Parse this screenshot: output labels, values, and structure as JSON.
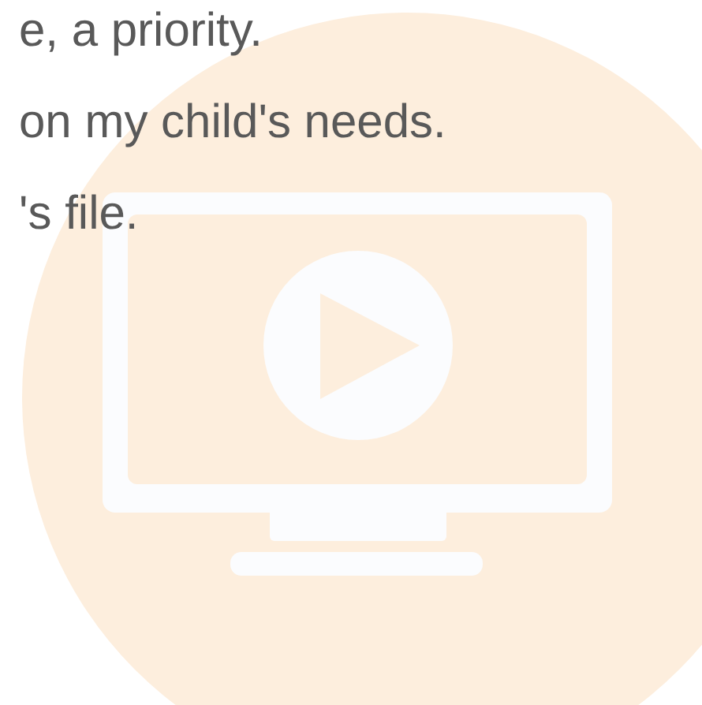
{
  "paragraph_lines": [
    "e, a priority.",
    "on my child's needs.",
    "'s file."
  ]
}
